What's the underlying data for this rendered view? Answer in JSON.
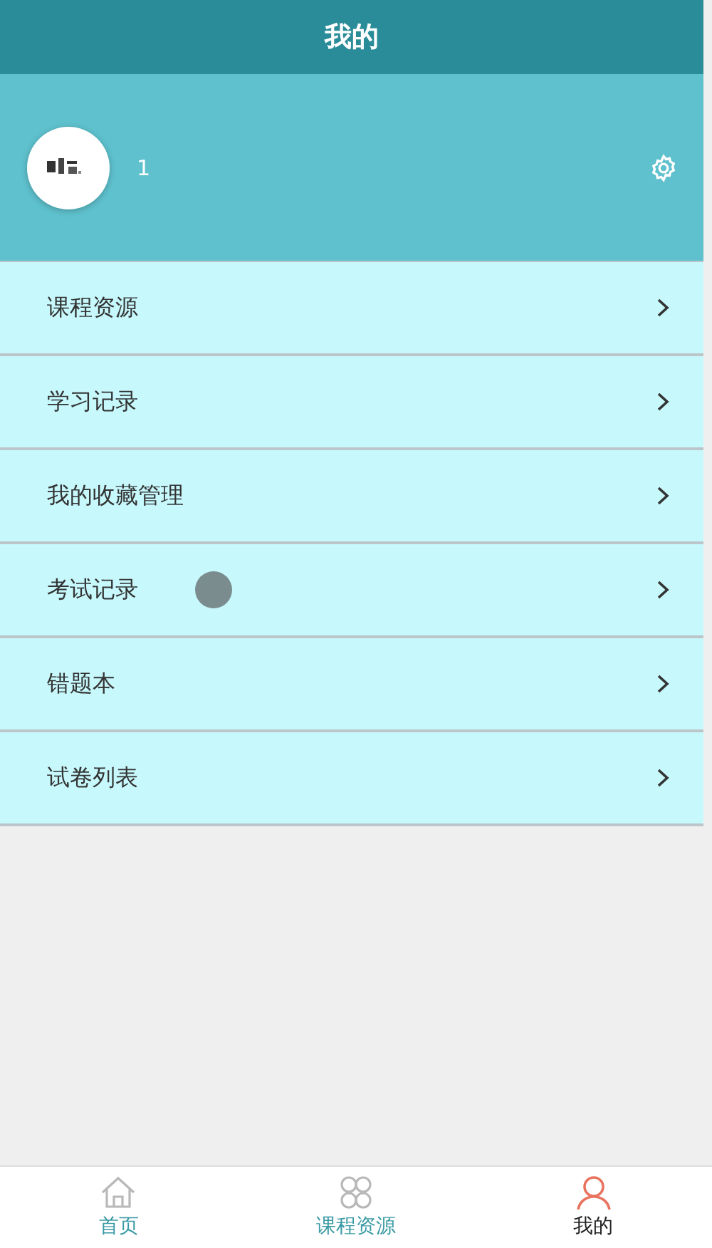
{
  "header": {
    "title": "我的"
  },
  "profile": {
    "username": "1"
  },
  "menu": [
    {
      "label": "课程资源"
    },
    {
      "label": "学习记录"
    },
    {
      "label": "我的收藏管理"
    },
    {
      "label": "考试记录"
    },
    {
      "label": "错题本"
    },
    {
      "label": "试卷列表"
    }
  ],
  "tab_bar": [
    {
      "label": "首页",
      "kind": "home",
      "selected": false
    },
    {
      "label": "课程资源",
      "kind": "grid",
      "selected": false
    },
    {
      "label": "我的",
      "kind": "person",
      "selected": true
    }
  ]
}
